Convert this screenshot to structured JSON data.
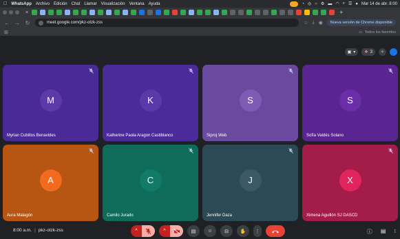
{
  "menubar": {
    "apple": "",
    "app": "WhatsApp",
    "items": [
      "Archivo",
      "Edición",
      "Chat",
      "Llamar",
      "Visualización",
      "Ventana",
      "Ayuda"
    ],
    "datetime": "Mar 14 de abr. 8:00"
  },
  "tabs": {
    "favicon_colors": [
      "#34a853",
      "#8ab4f8",
      "#34a853",
      "#34a853",
      "#8ab4f8",
      "#34a853",
      "#34a853",
      "#8ab4f8",
      "#34a853",
      "#8ab4f8",
      "#34a853",
      "#8ab4f8",
      "#34a853",
      "#1a73e8",
      "#5f6368",
      "#1a73e8",
      "#34a853",
      "#ea4335",
      "#34a853",
      "#8ab4f8",
      "#34a853",
      "#34a853",
      "#8ab4f8",
      "#34a853",
      "#5f6368",
      "#5f6368",
      "#34a853",
      "#5f6368",
      "#5f6368",
      "#34a853",
      "#5f6368",
      "#5f6368",
      "#ea4335",
      "#fbbc05",
      "#34a853",
      "#34a853",
      "#ea4335"
    ],
    "close": "×",
    "plus": "+"
  },
  "address": {
    "url": "meet.google.com/pkz-otzk-zss",
    "chrome_update": "Nueva versión de Chrome disponible"
  },
  "bookmarks": {
    "all_label": "Todos los favoritos"
  },
  "toolbar_right": {
    "reaction_count": "3"
  },
  "participants": [
    {
      "initial": "M",
      "name": "Myrian Cubillos Benavides",
      "bg": "#4a2a96",
      "avatar": "#5e3aa8"
    },
    {
      "initial": "K",
      "name": "Katherine Paola Aragon Castiblanco",
      "bg": "#4b2b9a",
      "avatar": "#5a39a9"
    },
    {
      "initial": "S",
      "name": "Siproj Web",
      "bg": "#6a4a9e",
      "avatar": "#7e5bb5"
    },
    {
      "initial": "S",
      "name": "Sofía Valdés Solano",
      "bg": "#5a2590",
      "avatar": "#6c2ea8"
    },
    {
      "initial": "A",
      "name": "Aura Malagón",
      "bg": "#b75512",
      "avatar": "#f26a1e"
    },
    {
      "initial": "C",
      "name": "Camilo Jurado",
      "bg": "#0f6b5a",
      "avatar": "#127b68"
    },
    {
      "initial": "J",
      "name": "Jennifer Daza",
      "bg": "#2b4a55",
      "avatar": "#3a5865"
    },
    {
      "initial": "X",
      "name": "Ximena Aguillón SJ DASCD",
      "bg": "#a31c4a",
      "avatar": "#e0245e"
    }
  ],
  "meeting": {
    "time": "8:00 a.m.",
    "code": "pkz-otzk-zss",
    "sep": "|"
  },
  "colors": {
    "danger": "#ea4335",
    "mic_off_bg": "#f6aea9"
  }
}
